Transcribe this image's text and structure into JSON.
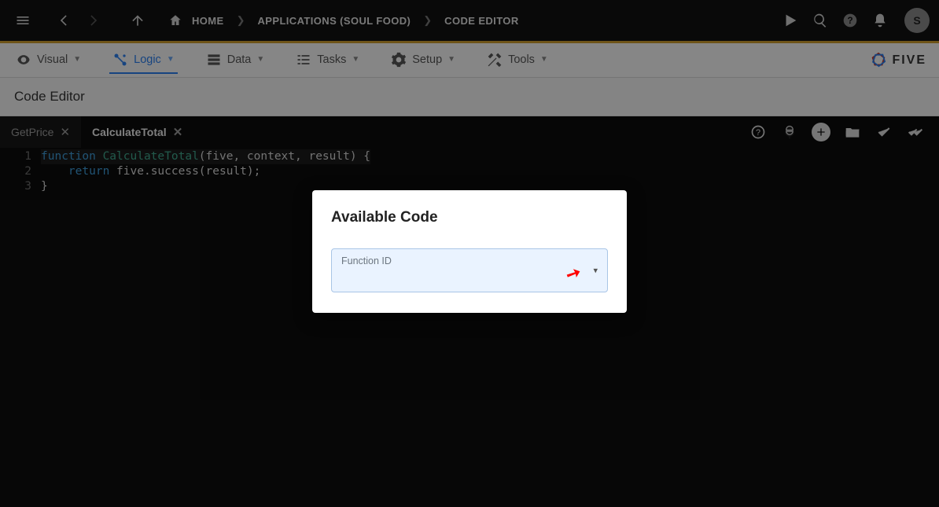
{
  "breadcrumbs": {
    "home": "HOME",
    "item1": "APPLICATIONS (SOUL FOOD)",
    "item2": "CODE EDITOR"
  },
  "avatar_initial": "S",
  "nav": {
    "visual": "Visual",
    "logic": "Logic",
    "data": "Data",
    "tasks": "Tasks",
    "setup": "Setup",
    "tools": "Tools"
  },
  "brand_text": "FIVE",
  "page_subtitle": "Code Editor",
  "tabs": {
    "t1": "GetPrice",
    "t2": "CalculateTotal"
  },
  "gutter": {
    "l1": "1",
    "l2": "2",
    "l3": "3"
  },
  "code": {
    "l1_kw": "function",
    "l1_fn": "CalculateTotal",
    "l1_rest": "(five, context, result) {",
    "l2_indent": "    ",
    "l2_kw": "return",
    "l2_rest": " five.success(result);",
    "l3": "}"
  },
  "modal": {
    "title": "Available Code",
    "field_label": "Function ID"
  }
}
